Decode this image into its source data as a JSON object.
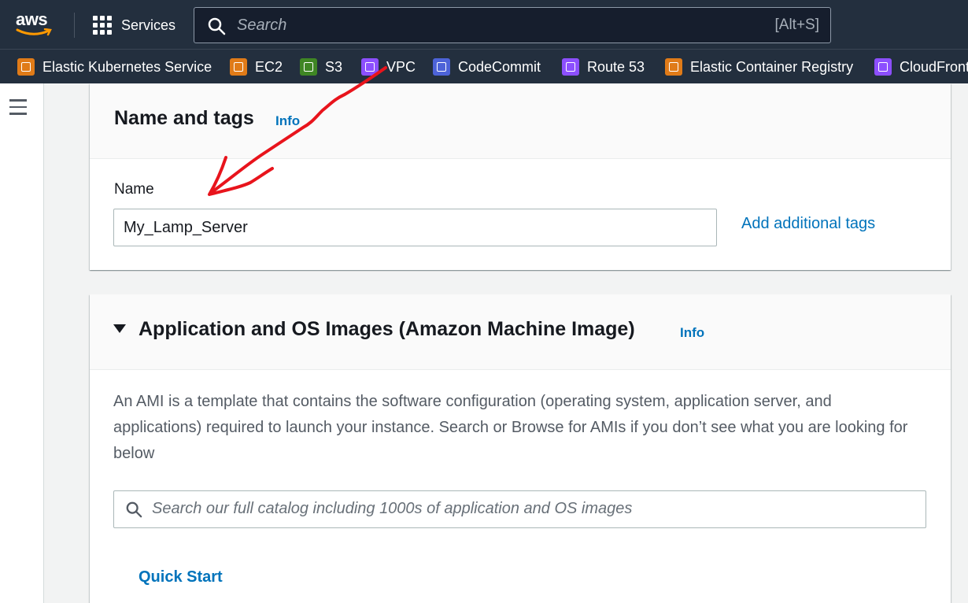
{
  "topbar": {
    "logo_text": "aws",
    "services_label": "Services",
    "search_placeholder": "Search",
    "search_shortcut": "[Alt+S]"
  },
  "favorites": [
    {
      "label": "Elastic Kubernetes Service",
      "icon": "eks-icon",
      "color": "#e07b18"
    },
    {
      "label": "EC2",
      "icon": "ec2-icon",
      "color": "#e07b18"
    },
    {
      "label": "S3",
      "icon": "s3-icon",
      "color": "#3f8624"
    },
    {
      "label": "VPC",
      "icon": "vpc-icon",
      "color": "#8c4fff"
    },
    {
      "label": "CodeCommit",
      "icon": "codecommit-icon",
      "color": "#4d63d8"
    },
    {
      "label": "Route 53",
      "icon": "route53-icon",
      "color": "#8c4fff"
    },
    {
      "label": "Elastic Container Registry",
      "icon": "ecr-icon",
      "color": "#e07b18"
    },
    {
      "label": "CloudFront",
      "icon": "cloudfront-icon",
      "color": "#8c4fff"
    }
  ],
  "name_and_tags": {
    "title": "Name and tags",
    "info": "Info",
    "name_label": "Name",
    "name_value": "My_Lamp_Server",
    "add_tags": "Add additional tags"
  },
  "ami": {
    "title": "Application and OS Images (Amazon Machine Image)",
    "info": "Info",
    "description": "An AMI is a template that contains the software configuration (operating system, application server, and applications) required to launch your instance. Search or Browse for AMIs if you don’t see what you are looking for below",
    "search_placeholder": "Search our full catalog including 1000s of application and OS images",
    "quick_start": "Quick Start"
  },
  "colors": {
    "nav_bg": "#232f3e",
    "link": "#0073bb",
    "annotation": "#e8141c"
  }
}
